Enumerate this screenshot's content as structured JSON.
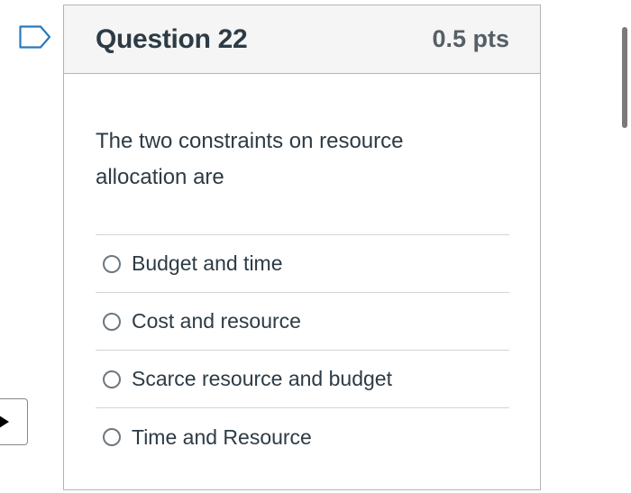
{
  "question": {
    "title": "Question 22",
    "points": "0.5 pts",
    "text": "The two constraints on resource allocation are",
    "flag_icon": "flag-icon",
    "answers": [
      {
        "label": "Budget and time",
        "selected": false
      },
      {
        "label": "Cost and resource",
        "selected": false
      },
      {
        "label": "Scarce resource and budget",
        "selected": false
      },
      {
        "label": "Time and Resource",
        "selected": false
      }
    ]
  },
  "side_button": {
    "icon": "play-icon"
  },
  "colors": {
    "header_bg": "#f5f5f5",
    "text": "#2d3b45",
    "flag_outline": "#2b7abc",
    "border": "#b5b5b5"
  }
}
